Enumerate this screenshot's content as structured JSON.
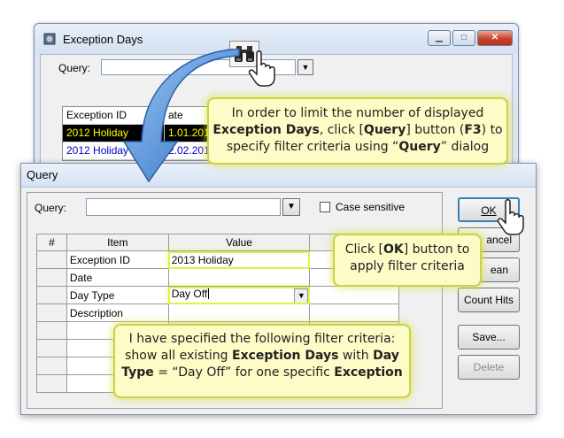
{
  "bg_window": {
    "title": "Exception Days",
    "query_label": "Query:",
    "columns": [
      "Exception ID",
      "ate"
    ],
    "rows": [
      {
        "id": "2012 Holiday",
        "date": "1.01.201"
      },
      {
        "id": "2012 Holiday",
        "date": "2.02.201"
      }
    ]
  },
  "dialog": {
    "title": "Query",
    "query_label": "Query:",
    "query_value": "",
    "case_sensitive_label": "Case sensitive",
    "grid": {
      "headers": [
        "#",
        "Item",
        "Value"
      ],
      "rows": [
        {
          "item": "Exception ID",
          "value": "2013 Holiday"
        },
        {
          "item": "Date",
          "value": ""
        },
        {
          "item": "Day Type",
          "value": "Day Off"
        },
        {
          "item": "Description",
          "value": ""
        }
      ]
    },
    "buttons": {
      "ok": "OK",
      "cancel": "ancel",
      "clean": "ean",
      "count_hits": "Count Hits",
      "save": "Save...",
      "delete": "Delete"
    }
  },
  "callouts": {
    "c1_a": "In order to limit the number of displayed",
    "c1_b_bold": "Exception Days",
    "c1_b": ", click [",
    "c1_b_bold2": "Query",
    "c1_b2": "] button (",
    "c1_b_bold3": "F3",
    "c1_b3": ") to",
    "c1_c": "specify filter criteria using “",
    "c1_c_bold": "Query",
    "c1_c2": "” dialog",
    "c2_a": "Click [",
    "c2_a_bold": "OK",
    "c2_a2": "] button to",
    "c2_b": "apply filter criteria",
    "c3_a": "I have specified the following filter criteria:",
    "c3_b": "show all existing ",
    "c3_b_bold": "Exception Days",
    "c3_b2": " with ",
    "c3_b_bold2": "Day",
    "c3_c_bold": "Type",
    "c3_c": " = “Day Off” for one specific ",
    "c3_c_bold2": "Exception"
  },
  "colors": {
    "callout_bg": "#fdfbc6",
    "callout_border": "#c9d248",
    "arrow_blue": "#3d7fd0",
    "selected_row_bg": "#000000",
    "selected_row_fg": "#ffff00"
  },
  "icons": [
    "app-icon",
    "binoculars-icon",
    "hand-pointer-icon",
    "curved-arrow-icon",
    "minimize-icon",
    "maximize-icon",
    "close-icon",
    "chevron-down-icon"
  ]
}
